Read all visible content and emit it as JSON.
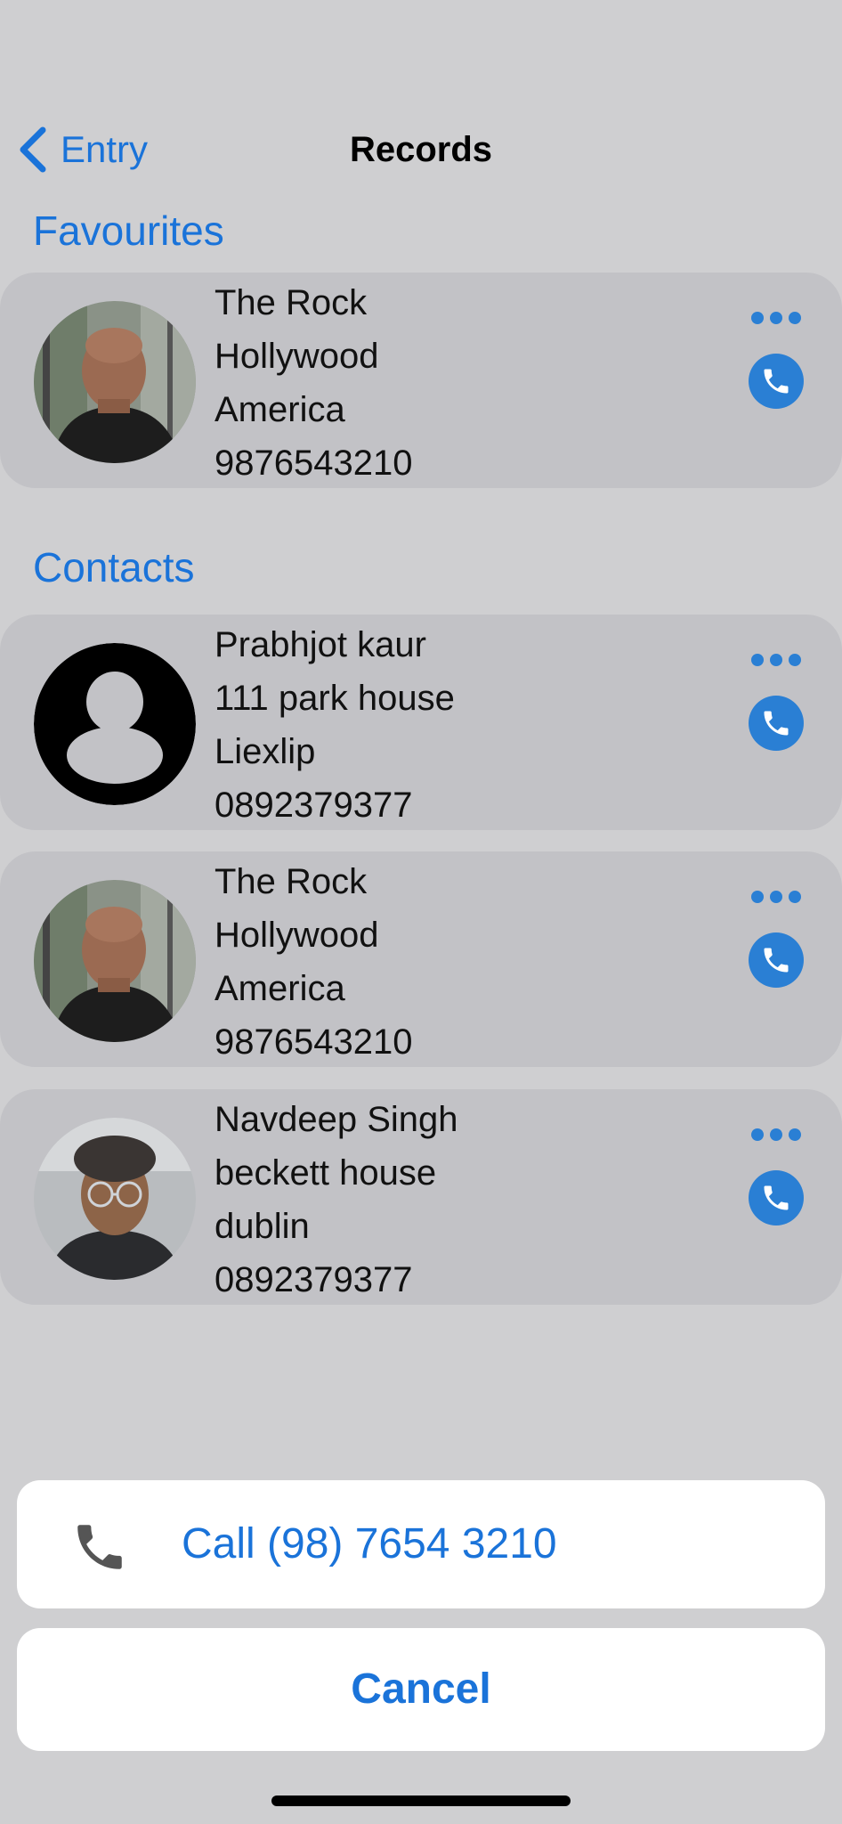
{
  "nav": {
    "back_label": "Entry",
    "title": "Records"
  },
  "sections": {
    "favourites": "Favourites",
    "contacts": "Contacts"
  },
  "favourites": [
    {
      "name": "The Rock",
      "address": "Hollywood",
      "city": "America",
      "phone": "9876543210",
      "avatar": "photo-bald-man"
    }
  ],
  "contacts": [
    {
      "name": "Prabhjot kaur",
      "address": "111 park house",
      "city": "Liexlip",
      "phone": "0892379377",
      "avatar": "person-placeholder-icon"
    },
    {
      "name": "The Rock",
      "address": "Hollywood",
      "city": "America",
      "phone": "9876543210",
      "avatar": "photo-bald-man"
    },
    {
      "name": "Navdeep Singh",
      "address": "beckett house",
      "city": "dublin",
      "phone": "0892379377",
      "avatar": "photo-man-glasses"
    }
  ],
  "action_sheet": {
    "call_label": "Call (98) 7654 3210",
    "cancel_label": "Cancel"
  },
  "colors": {
    "accent": "#1a73d9",
    "button_blue": "#2a7fd4",
    "card_bg": "#c2c2c6",
    "screen_bg": "#cfcfd1"
  }
}
